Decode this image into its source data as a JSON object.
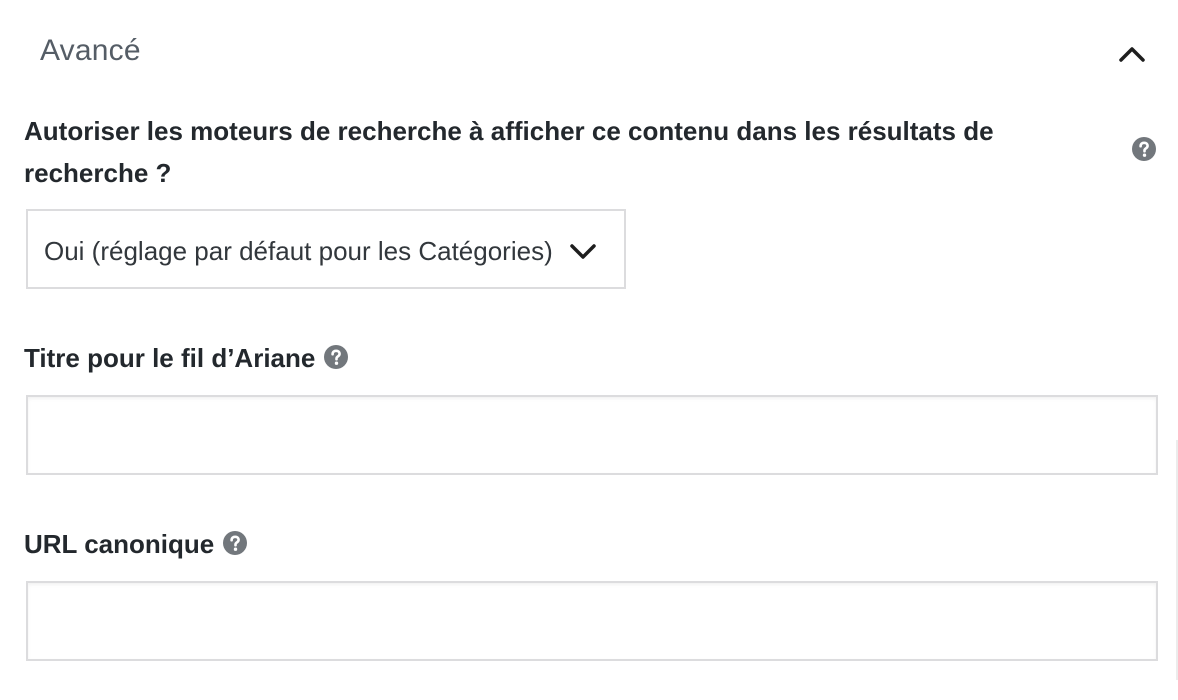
{
  "panel": {
    "title": "Avancé",
    "collapse_icon": "chevron-up-icon"
  },
  "robots": {
    "label": "Autoriser les moteurs de recherche à afficher ce contenu dans les résultats de recherche ?",
    "help_icon": "question-circle-icon",
    "select_value": "Oui (réglage par défaut pour les Catégories)",
    "select_icon": "chevron-down-icon"
  },
  "breadcrumb_title": {
    "label": "Titre pour le fil d’Ariane",
    "help_icon": "question-circle-icon",
    "value": ""
  },
  "canonical_url": {
    "label": "URL canonique",
    "help_icon": "question-circle-icon",
    "value": ""
  },
  "colors": {
    "help_icon": "#72777c",
    "border": "#dcdcde",
    "label_text": "#23282d",
    "title_text": "#555d66"
  }
}
